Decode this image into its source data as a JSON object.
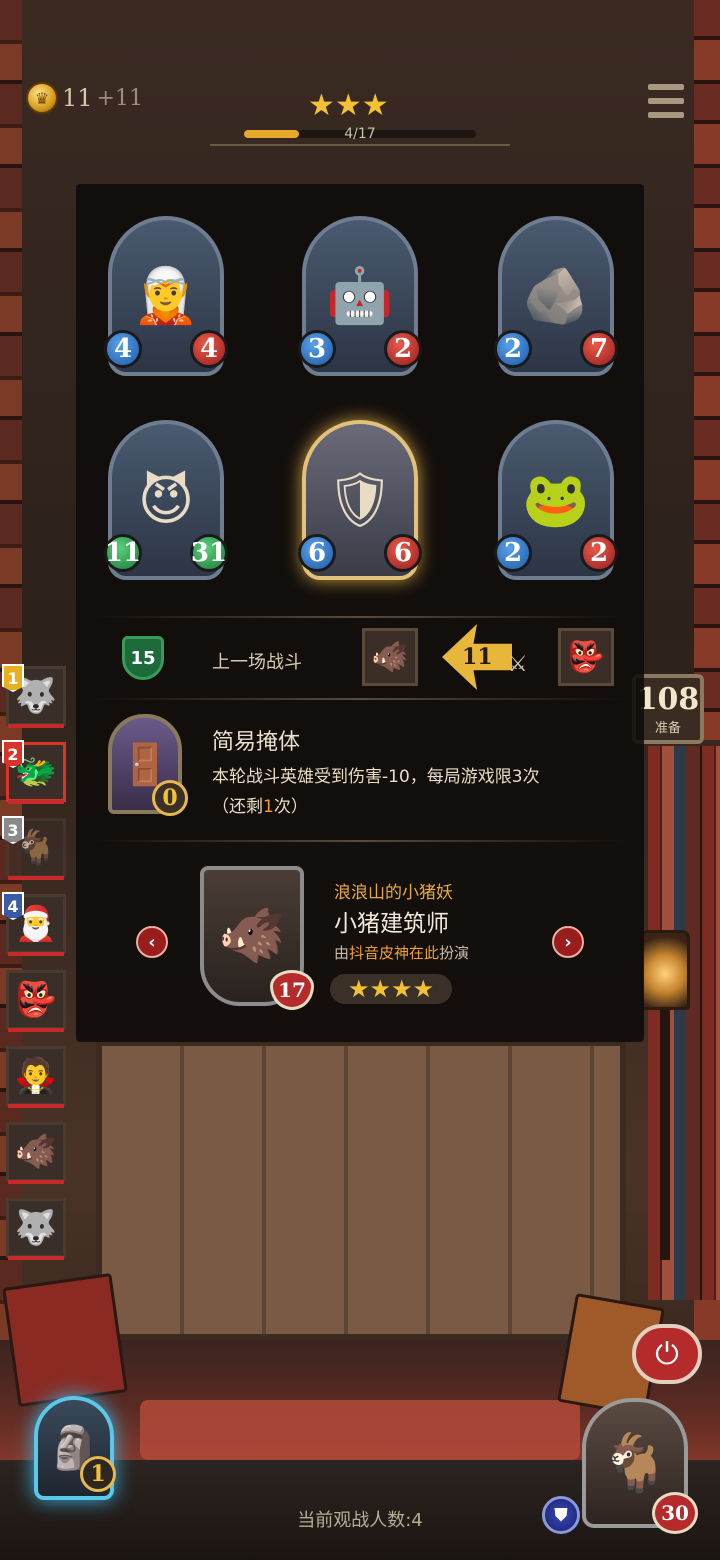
{
  "hud": {
    "gold": "11",
    "gold_income": "+11",
    "stars": "★★★",
    "round_progress": "4/17",
    "round_fraction": 0.235
  },
  "lineup": [
    {
      "icon": "elf-warrior",
      "face": "🧝",
      "attack": "4",
      "health": "4",
      "highlight": false
    },
    {
      "icon": "drill-robot",
      "face": "🤖",
      "attack": "3",
      "health": "2",
      "highlight": false
    },
    {
      "icon": "rock-golem",
      "face": "🪨",
      "attack": "2",
      "health": "7",
      "highlight": false
    },
    {
      "icon": "grinning-demon",
      "face": "😈",
      "attack": "11",
      "health": "31",
      "highlight": false
    },
    {
      "icon": "armored-knight",
      "face": "🛡",
      "attack": "6",
      "health": "6",
      "highlight": true
    },
    {
      "icon": "frog-dragon",
      "face": "🐸",
      "attack": "2",
      "health": "2",
      "highlight": false
    }
  ],
  "last_battle": {
    "shield_value": "15",
    "label": "上一场战斗",
    "attacker_face": "🐗",
    "damage": "11",
    "defender_face": "👺"
  },
  "item": {
    "icon": "wooden-shield",
    "title": "简易掩体",
    "cost": "0",
    "description": "本轮战斗英雄受到伤害-10，每局游戏限3次",
    "remaining_prefix": "（还剩",
    "remaining_count": "1",
    "remaining_suffix": "次）"
  },
  "player": {
    "face": "🐗",
    "health": "17",
    "subtitle": "浪浪山的小猪妖",
    "name": "小猪建筑师",
    "played_by_prefix": "由",
    "played_by_name": "抖音皮神在此",
    "played_by_suffix": "扮演",
    "stars": "★★★★",
    "prev_label": "‹",
    "next_label": "›"
  },
  "roster": [
    {
      "rank": "1",
      "face": "🐺",
      "style": "gold"
    },
    {
      "rank": "2",
      "face": "🐲",
      "style": "red"
    },
    {
      "rank": "3",
      "face": "🐐",
      "style": "gray"
    },
    {
      "rank": "4",
      "face": "🎅",
      "style": "blue"
    },
    {
      "rank": "",
      "face": "👺",
      "style": ""
    },
    {
      "rank": "",
      "face": "🧛",
      "style": ""
    },
    {
      "rank": "",
      "face": "🐗",
      "style": ""
    },
    {
      "rank": "",
      "face": "🐺",
      "style": ""
    }
  ],
  "countdown": {
    "value": "108",
    "label": "准备"
  },
  "bottom": {
    "my_hero_face": "🗿",
    "my_level": "1",
    "spectators": "当前观战人数:4",
    "opponent_face": "🐐",
    "opponent_health": "30"
  },
  "colors": {
    "gold": "#f3c234",
    "attack": "#1d5aa8",
    "health": "#9a1d1d",
    "buff": "#1d7a3a",
    "highlight_orange": "#f0a02a"
  }
}
